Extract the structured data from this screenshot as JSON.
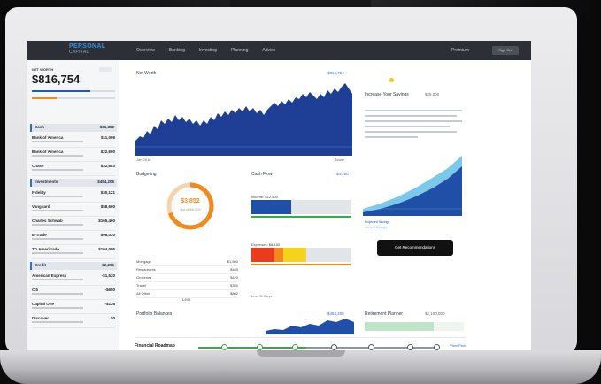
{
  "topbar": {
    "logo": "PERSONAL",
    "logo_sub": "CAPITAL",
    "nav": [
      "Overview",
      "Banking",
      "Investing",
      "Planning",
      "Advice"
    ],
    "user": "Premium",
    "signout": "Sign Out"
  },
  "sidebar": {
    "networth_label": "NET WORTH",
    "networth_value": "$816,754",
    "pill": "",
    "sections": [
      {
        "label": "Cash",
        "value": "$66,382"
      },
      {
        "label": "Investments",
        "value": "$454,206"
      },
      {
        "label": "Credit",
        "value": "-$2,296"
      }
    ],
    "rows": [
      {
        "name": "Bank of America",
        "value": "$11,009"
      },
      {
        "name": "Bank of America",
        "value": "$22,600"
      },
      {
        "name": "Chase",
        "value": "$32,883"
      },
      {
        "name": "Fidelity",
        "value": "$30,121"
      },
      {
        "name": "Vanguard",
        "value": "$58,600"
      },
      {
        "name": "Charles Schwab",
        "value": "$165,460"
      },
      {
        "name": "E*Trade",
        "value": "$96,020"
      },
      {
        "name": "TD Ameritrade",
        "value": "$104,005"
      },
      {
        "name": "American Express",
        "value": "-$1,520"
      },
      {
        "name": "Citi",
        "value": "-$650"
      },
      {
        "name": "Capital One",
        "value": "-$126"
      },
      {
        "name": "Discover",
        "value": "$0"
      }
    ]
  },
  "networth_chart": {
    "title": "Net Worth",
    "link": "$816,754",
    "foot_left": "Jan 2016",
    "foot_right": "Today"
  },
  "budget": {
    "title": "Budgeting",
    "amount": "$3,852",
    "sub": "out of $5,500",
    "rows": [
      {
        "label": "Mortgage",
        "value": "$1,800"
      },
      {
        "label": "Restaurants",
        "value": "$480"
      },
      {
        "label": "Groceries",
        "value": "$420"
      },
      {
        "label": "Travel",
        "value": "$350"
      },
      {
        "label": "All Other",
        "value": "$802"
      }
    ],
    "more": "Less"
  },
  "cashflow": {
    "title": "Cash Flow",
    "link": "$4,250",
    "income_label": "Income: $12,400",
    "expense_label": "Expenses: $8,150",
    "footnote": "Last 30 Days"
  },
  "recommendation": {
    "title": "Increase Your Savings",
    "link": "$25,000",
    "button": "Get Recommendations",
    "legend": [
      "Projected Savings",
      "Current Savings"
    ]
  },
  "investments": {
    "title": "Portfolio Balances",
    "link": "$454,206"
  },
  "retirement": {
    "title": "Retirement Planner",
    "link": "$2,100,000"
  },
  "timeline": {
    "label": "Financial Roadmap",
    "text": "View Plan"
  },
  "colors": {
    "accent_blue": "#1f4fa6",
    "accent_orange": "#f08a1c",
    "accent_green": "#2fae4a",
    "accent_yellow": "#f5d21b",
    "accent_red": "#e83c1c"
  }
}
